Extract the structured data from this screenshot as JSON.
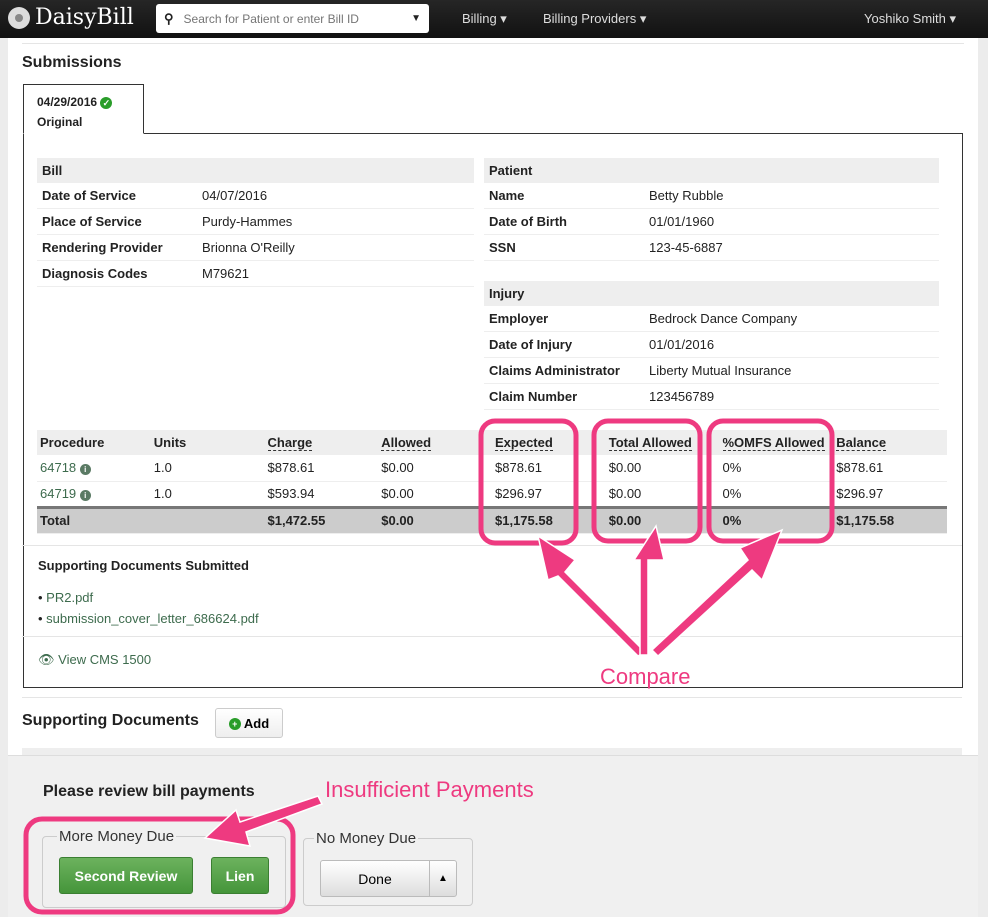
{
  "nav": {
    "brand": "DaisyBill",
    "search_placeholder": "Search for Patient or enter Bill ID",
    "billing": "Billing ▾",
    "billing_providers": "Billing Providers ▾",
    "user": "Yoshiko Smith ▾"
  },
  "submissions": {
    "title": "Submissions",
    "tab_date": "04/29/2016",
    "tab_label": "Original"
  },
  "bill": {
    "header": "Bill",
    "rows": [
      [
        "Date of Service",
        "04/07/2016"
      ],
      [
        "Place of Service",
        "Purdy-Hammes"
      ],
      [
        "Rendering Provider",
        "Brionna O'Reilly"
      ],
      [
        "Diagnosis Codes",
        "M79621"
      ]
    ]
  },
  "patient": {
    "header": "Patient",
    "rows": [
      [
        "Name",
        "Betty Rubble"
      ],
      [
        "Date of Birth",
        "01/01/1960"
      ],
      [
        "SSN",
        "123-45-6887"
      ]
    ]
  },
  "injury": {
    "header": "Injury",
    "rows": [
      [
        "Employer",
        "Bedrock Dance Company"
      ],
      [
        "Date of Injury",
        "01/01/2016"
      ],
      [
        "Claims Administrator",
        "Liberty Mutual Insurance"
      ],
      [
        "Claim Number",
        "123456789"
      ]
    ]
  },
  "procedures": {
    "headers": [
      "Procedure",
      "Units",
      "Charge",
      "Allowed",
      "Expected",
      "Total Allowed",
      "%OMFS Allowed",
      "Balance"
    ],
    "rows": [
      [
        "64718",
        "1.0",
        "$878.61",
        "$0.00",
        "$878.61",
        "$0.00",
        "0%",
        "$878.61"
      ],
      [
        "64719",
        "1.0",
        "$593.94",
        "$0.00",
        "$296.97",
        "$0.00",
        "0%",
        "$296.97"
      ]
    ],
    "total": [
      "Total",
      "",
      "$1,472.55",
      "$0.00",
      "$1,175.58",
      "$0.00",
      "0%",
      "$1,175.58"
    ]
  },
  "docs": {
    "title": "Supporting Documents Submitted",
    "items": [
      "PR2.pdf",
      "submission_cover_letter_686624.pdf"
    ],
    "view_cms": "View CMS 1500"
  },
  "supporting": {
    "title": "Supporting Documents",
    "add": "Add"
  },
  "review": {
    "title": "Please review bill payments",
    "more_due": "More Money Due",
    "second_review": "Second Review",
    "lien": "Lien",
    "no_due": "No Money Due",
    "done": "Done"
  },
  "annotations": {
    "compare": "Compare",
    "insufficient": "Insufficient Payments",
    "color": "#ee3a80"
  }
}
